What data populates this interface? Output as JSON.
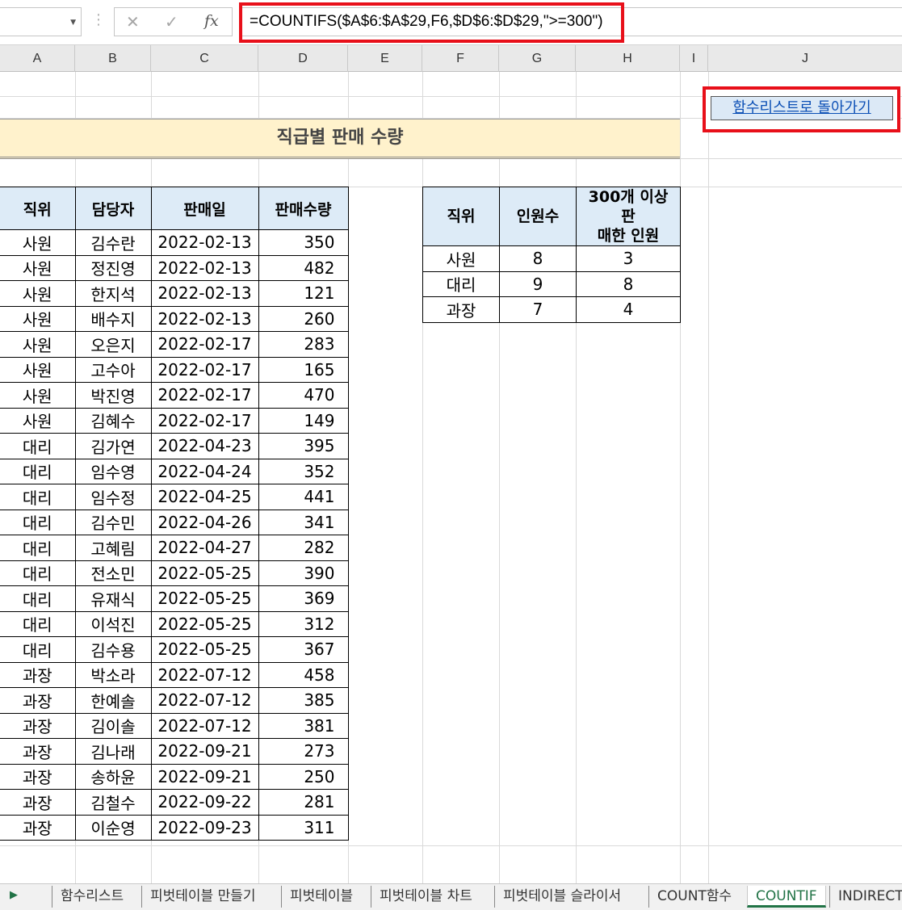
{
  "formula_bar": {
    "name_box": "",
    "formula": "=COUNTIFS($A$6:$A$29,F6,$D$6:$D$29,\">=300\")",
    "cancel_icon": "close-icon",
    "enter_icon": "check-icon",
    "fx_label": "fx"
  },
  "columns": [
    "A",
    "B",
    "C",
    "D",
    "E",
    "F",
    "G",
    "H",
    "I",
    "J"
  ],
  "title": "직급별 판매 수량",
  "back_link": "함수리스트로 돌아가기",
  "sales_table": {
    "headers": [
      "직위",
      "담당자",
      "판매일",
      "판매수량"
    ],
    "rows": [
      [
        "사원",
        "김수란",
        "2022-02-13",
        "350"
      ],
      [
        "사원",
        "정진영",
        "2022-02-13",
        "482"
      ],
      [
        "사원",
        "한지석",
        "2022-02-13",
        "121"
      ],
      [
        "사원",
        "배수지",
        "2022-02-13",
        "260"
      ],
      [
        "사원",
        "오은지",
        "2022-02-17",
        "283"
      ],
      [
        "사원",
        "고수아",
        "2022-02-17",
        "165"
      ],
      [
        "사원",
        "박진영",
        "2022-02-17",
        "470"
      ],
      [
        "사원",
        "김혜수",
        "2022-02-17",
        "149"
      ],
      [
        "대리",
        "김가연",
        "2022-04-23",
        "395"
      ],
      [
        "대리",
        "임수영",
        "2022-04-24",
        "352"
      ],
      [
        "대리",
        "임수정",
        "2022-04-25",
        "441"
      ],
      [
        "대리",
        "김수민",
        "2022-04-26",
        "341"
      ],
      [
        "대리",
        "고혜림",
        "2022-04-27",
        "282"
      ],
      [
        "대리",
        "전소민",
        "2022-05-25",
        "390"
      ],
      [
        "대리",
        "유재식",
        "2022-05-25",
        "369"
      ],
      [
        "대리",
        "이석진",
        "2022-05-25",
        "312"
      ],
      [
        "대리",
        "김수용",
        "2022-05-25",
        "367"
      ],
      [
        "과장",
        "박소라",
        "2022-07-12",
        "458"
      ],
      [
        "과장",
        "한예솔",
        "2022-07-12",
        "385"
      ],
      [
        "과장",
        "김이솔",
        "2022-07-12",
        "381"
      ],
      [
        "과장",
        "김나래",
        "2022-09-21",
        "273"
      ],
      [
        "과장",
        "송하윤",
        "2022-09-21",
        "250"
      ],
      [
        "과장",
        "김철수",
        "2022-09-22",
        "281"
      ],
      [
        "과장",
        "이순영",
        "2022-09-23",
        "311"
      ]
    ]
  },
  "summary_table": {
    "headers": [
      "직위",
      "인원수",
      "300개 이상 판\n매한 인원"
    ],
    "rows": [
      [
        "사원",
        "8",
        "3"
      ],
      [
        "대리",
        "9",
        "8"
      ],
      [
        "과장",
        "7",
        "4"
      ]
    ]
  },
  "sheet_tabs": {
    "items": [
      "함수리스트",
      "피벗테이블 만들기",
      "피벗테이블",
      "피벗테이블 차트",
      "피벗테이블 슬라이서",
      "COUNT함수",
      "COUNTIF",
      "INDIRECT"
    ],
    "active": "COUNTIF"
  },
  "colors": {
    "highlight_border": "#e8101a",
    "title_fill": "#fff2cc",
    "header_fill": "#ddebf7",
    "link_fill": "#dce9f6",
    "active_tab": "#217346"
  }
}
